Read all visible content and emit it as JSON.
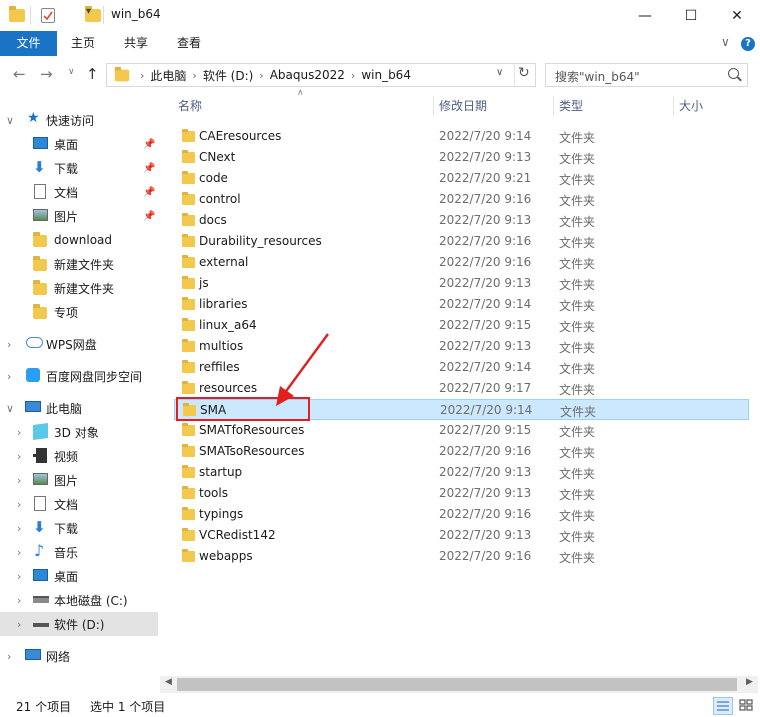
{
  "window": {
    "title": "win_b64",
    "minimize_glyph": "—",
    "maximize_glyph": "☐",
    "close_glyph": "✕"
  },
  "ribbon": {
    "tabs": [
      "文件",
      "主页",
      "共享",
      "查看"
    ],
    "collapse_glyph": "∨",
    "help_glyph": "?"
  },
  "address": {
    "crumbs": [
      "此电脑",
      "软件 (D:)",
      "Abaqus2022",
      "win_b64"
    ],
    "separator": "›"
  },
  "search": {
    "placeholder": "搜索\"win_b64\""
  },
  "sidebar": {
    "quick_access": "快速访问",
    "quick_items": [
      {
        "label": "桌面",
        "icon": "desktop-icon",
        "pinned": true
      },
      {
        "label": "下载",
        "icon": "download-icon",
        "pinned": true
      },
      {
        "label": "文档",
        "icon": "document-icon",
        "pinned": true
      },
      {
        "label": "图片",
        "icon": "picture-icon",
        "pinned": true
      },
      {
        "label": "download",
        "icon": "folder-icon",
        "pinned": false
      },
      {
        "label": "新建文件夹",
        "icon": "folder-icon",
        "pinned": false
      },
      {
        "label": "新建文件夹",
        "icon": "folder-icon",
        "pinned": false
      },
      {
        "label": "专项",
        "icon": "folder-icon",
        "pinned": false
      }
    ],
    "wps": "WPS网盘",
    "baidu": "百度网盘同步空间",
    "this_pc": "此电脑",
    "pc_items": [
      {
        "label": "3D 对象",
        "icon": "3d-objects-icon"
      },
      {
        "label": "视频",
        "icon": "video-icon"
      },
      {
        "label": "图片",
        "icon": "picture-icon"
      },
      {
        "label": "文档",
        "icon": "document-icon"
      },
      {
        "label": "下载",
        "icon": "download-icon"
      },
      {
        "label": "音乐",
        "icon": "music-icon"
      },
      {
        "label": "桌面",
        "icon": "desktop-icon"
      },
      {
        "label": "本地磁盘 (C:)",
        "icon": "drive-icon"
      },
      {
        "label": "软件 (D:)",
        "icon": "drive-icon"
      }
    ],
    "network": "网络"
  },
  "columns": {
    "name": "名称",
    "date": "修改日期",
    "type": "类型",
    "size": "大小"
  },
  "files": [
    {
      "name": "CAEresources",
      "date": "2022/7/20 9:14",
      "type": "文件夹"
    },
    {
      "name": "CNext",
      "date": "2022/7/20 9:13",
      "type": "文件夹"
    },
    {
      "name": "code",
      "date": "2022/7/20 9:21",
      "type": "文件夹"
    },
    {
      "name": "control",
      "date": "2022/7/20 9:16",
      "type": "文件夹"
    },
    {
      "name": "docs",
      "date": "2022/7/20 9:13",
      "type": "文件夹"
    },
    {
      "name": "Durability_resources",
      "date": "2022/7/20 9:16",
      "type": "文件夹"
    },
    {
      "name": "external",
      "date": "2022/7/20 9:16",
      "type": "文件夹"
    },
    {
      "name": "js",
      "date": "2022/7/20 9:13",
      "type": "文件夹"
    },
    {
      "name": "libraries",
      "date": "2022/7/20 9:14",
      "type": "文件夹"
    },
    {
      "name": "linux_a64",
      "date": "2022/7/20 9:15",
      "type": "文件夹"
    },
    {
      "name": "multios",
      "date": "2022/7/20 9:13",
      "type": "文件夹"
    },
    {
      "name": "reffiles",
      "date": "2022/7/20 9:14",
      "type": "文件夹"
    },
    {
      "name": "resources",
      "date": "2022/7/20 9:17",
      "type": "文件夹"
    },
    {
      "name": "SMA",
      "date": "2022/7/20 9:14",
      "type": "文件夹",
      "selected": true
    },
    {
      "name": "SMATfoResources",
      "date": "2022/7/20 9:15",
      "type": "文件夹"
    },
    {
      "name": "SMATsoResources",
      "date": "2022/7/20 9:16",
      "type": "文件夹"
    },
    {
      "name": "startup",
      "date": "2022/7/20 9:13",
      "type": "文件夹"
    },
    {
      "name": "tools",
      "date": "2022/7/20 9:13",
      "type": "文件夹"
    },
    {
      "name": "typings",
      "date": "2022/7/20 9:16",
      "type": "文件夹"
    },
    {
      "name": "VCRedist142",
      "date": "2022/7/20 9:13",
      "type": "文件夹"
    },
    {
      "name": "webapps",
      "date": "2022/7/20 9:16",
      "type": "文件夹"
    }
  ],
  "status": {
    "count": "21 个项目",
    "selected": "选中 1 个项目"
  },
  "colors": {
    "accent": "#1a73c5",
    "selection": "#cce8ff",
    "annotation": "#e02020"
  }
}
